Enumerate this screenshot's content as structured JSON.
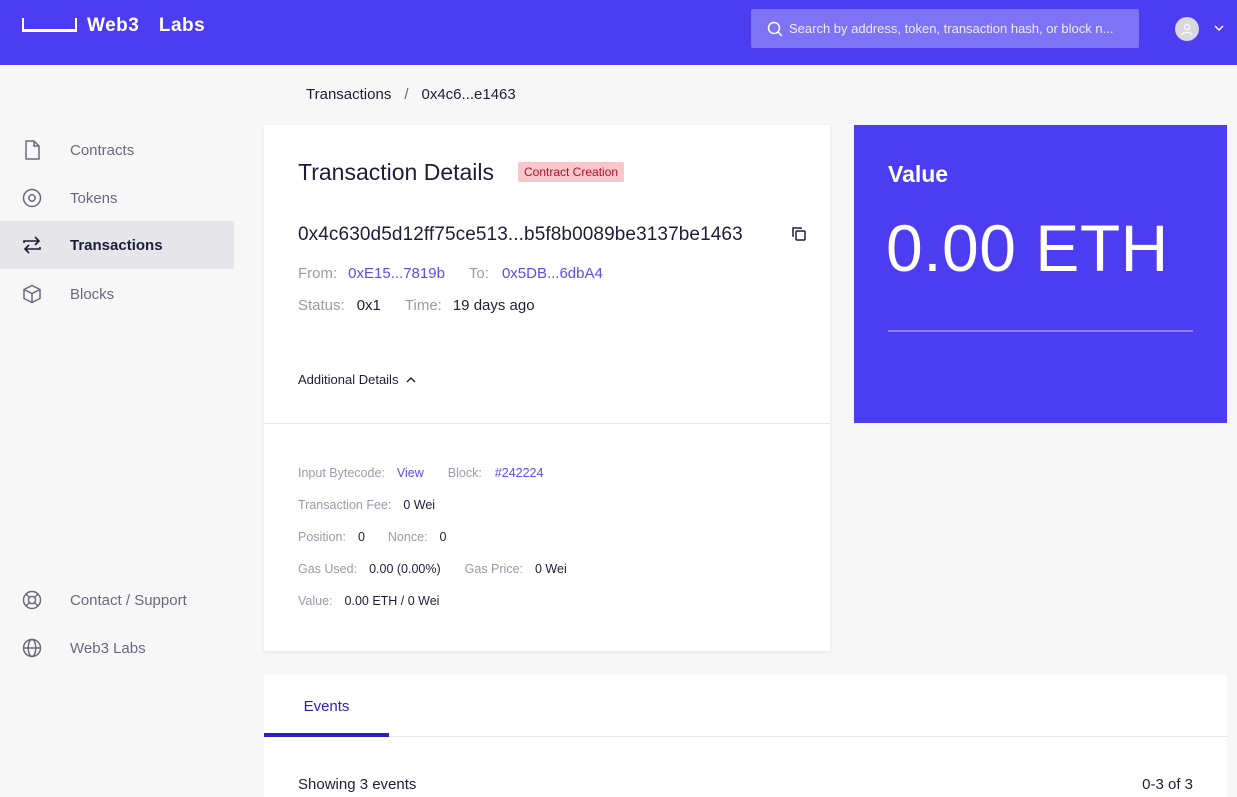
{
  "header": {
    "brand": "Web3  Labs",
    "search_placeholder": "Search by address, token, transaction hash, or block n..."
  },
  "sidebar": {
    "items": [
      {
        "label": "Contracts",
        "icon": "file-icon"
      },
      {
        "label": "Tokens",
        "icon": "token-icon"
      },
      {
        "label": "Transactions",
        "icon": "transactions-icon"
      },
      {
        "label": "Blocks",
        "icon": "cube-icon"
      }
    ],
    "footer": [
      {
        "label": "Contact / Support",
        "icon": "lifebuoy-icon"
      },
      {
        "label": "Web3 Labs",
        "icon": "globe-icon"
      }
    ],
    "active": "Transactions"
  },
  "breadcrumb": {
    "root": "Transactions",
    "sep": "/",
    "current": "0x4c6...e1463"
  },
  "details": {
    "title": "Transaction Details",
    "badge": "Contract Creation",
    "hash": "0x4c630d5d12ff75ce513...b5f8b0089be3137be1463",
    "from_label": "From:",
    "from": "0xE15...7819b",
    "to_label": "To:",
    "to": "0x5DB...6dbA4",
    "status_label": "Status:",
    "status": "0x1",
    "time_label": "Time:",
    "time": "19 days ago",
    "additional_label": "Additional Details",
    "input_label": "Input Bytecode:",
    "input_link": "View",
    "block_label": "Block:",
    "block": "#242224",
    "fee_label": "Transaction Fee:",
    "fee": "0 Wei",
    "position_label": "Position:",
    "position": "0",
    "nonce_label": "Nonce:",
    "nonce": "0",
    "gas_used_label": "Gas Used:",
    "gas_used": "0.00 (0.00%)",
    "gas_price_label": "Gas Price:",
    "gas_price": "0 Wei",
    "value_label": "Value:",
    "value": "0.00 ETH / 0 Wei"
  },
  "value_card": {
    "label": "Value",
    "amount": "0.00 ETH"
  },
  "events": {
    "tab": "Events",
    "count": "Showing 3 events",
    "range": "0-3 of 3"
  },
  "colors": {
    "brand": "#4c3df0",
    "link": "#5b4cf0",
    "badge_bg": "#f8c7cc",
    "badge_text": "#b5102a"
  }
}
